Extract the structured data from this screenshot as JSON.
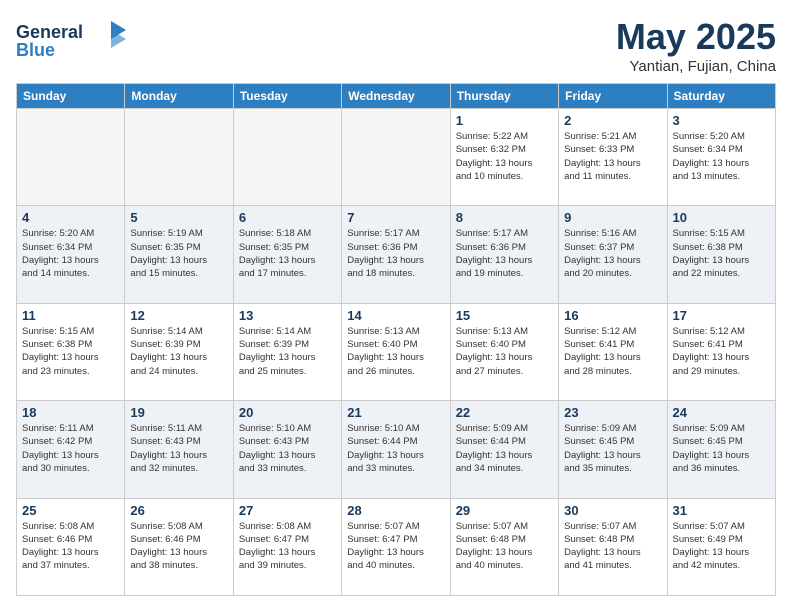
{
  "header": {
    "logo_line1": "General",
    "logo_line2": "Blue",
    "main_title": "May 2025",
    "subtitle": "Yantian, Fujian, China"
  },
  "days_of_week": [
    "Sunday",
    "Monday",
    "Tuesday",
    "Wednesday",
    "Thursday",
    "Friday",
    "Saturday"
  ],
  "weeks": [
    [
      {
        "day": "",
        "info": ""
      },
      {
        "day": "",
        "info": ""
      },
      {
        "day": "",
        "info": ""
      },
      {
        "day": "",
        "info": ""
      },
      {
        "day": "1",
        "info": "Sunrise: 5:22 AM\nSunset: 6:32 PM\nDaylight: 13 hours\nand 10 minutes."
      },
      {
        "day": "2",
        "info": "Sunrise: 5:21 AM\nSunset: 6:33 PM\nDaylight: 13 hours\nand 11 minutes."
      },
      {
        "day": "3",
        "info": "Sunrise: 5:20 AM\nSunset: 6:34 PM\nDaylight: 13 hours\nand 13 minutes."
      }
    ],
    [
      {
        "day": "4",
        "info": "Sunrise: 5:20 AM\nSunset: 6:34 PM\nDaylight: 13 hours\nand 14 minutes."
      },
      {
        "day": "5",
        "info": "Sunrise: 5:19 AM\nSunset: 6:35 PM\nDaylight: 13 hours\nand 15 minutes."
      },
      {
        "day": "6",
        "info": "Sunrise: 5:18 AM\nSunset: 6:35 PM\nDaylight: 13 hours\nand 17 minutes."
      },
      {
        "day": "7",
        "info": "Sunrise: 5:17 AM\nSunset: 6:36 PM\nDaylight: 13 hours\nand 18 minutes."
      },
      {
        "day": "8",
        "info": "Sunrise: 5:17 AM\nSunset: 6:36 PM\nDaylight: 13 hours\nand 19 minutes."
      },
      {
        "day": "9",
        "info": "Sunrise: 5:16 AM\nSunset: 6:37 PM\nDaylight: 13 hours\nand 20 minutes."
      },
      {
        "day": "10",
        "info": "Sunrise: 5:15 AM\nSunset: 6:38 PM\nDaylight: 13 hours\nand 22 minutes."
      }
    ],
    [
      {
        "day": "11",
        "info": "Sunrise: 5:15 AM\nSunset: 6:38 PM\nDaylight: 13 hours\nand 23 minutes."
      },
      {
        "day": "12",
        "info": "Sunrise: 5:14 AM\nSunset: 6:39 PM\nDaylight: 13 hours\nand 24 minutes."
      },
      {
        "day": "13",
        "info": "Sunrise: 5:14 AM\nSunset: 6:39 PM\nDaylight: 13 hours\nand 25 minutes."
      },
      {
        "day": "14",
        "info": "Sunrise: 5:13 AM\nSunset: 6:40 PM\nDaylight: 13 hours\nand 26 minutes."
      },
      {
        "day": "15",
        "info": "Sunrise: 5:13 AM\nSunset: 6:40 PM\nDaylight: 13 hours\nand 27 minutes."
      },
      {
        "day": "16",
        "info": "Sunrise: 5:12 AM\nSunset: 6:41 PM\nDaylight: 13 hours\nand 28 minutes."
      },
      {
        "day": "17",
        "info": "Sunrise: 5:12 AM\nSunset: 6:41 PM\nDaylight: 13 hours\nand 29 minutes."
      }
    ],
    [
      {
        "day": "18",
        "info": "Sunrise: 5:11 AM\nSunset: 6:42 PM\nDaylight: 13 hours\nand 30 minutes."
      },
      {
        "day": "19",
        "info": "Sunrise: 5:11 AM\nSunset: 6:43 PM\nDaylight: 13 hours\nand 32 minutes."
      },
      {
        "day": "20",
        "info": "Sunrise: 5:10 AM\nSunset: 6:43 PM\nDaylight: 13 hours\nand 33 minutes."
      },
      {
        "day": "21",
        "info": "Sunrise: 5:10 AM\nSunset: 6:44 PM\nDaylight: 13 hours\nand 33 minutes."
      },
      {
        "day": "22",
        "info": "Sunrise: 5:09 AM\nSunset: 6:44 PM\nDaylight: 13 hours\nand 34 minutes."
      },
      {
        "day": "23",
        "info": "Sunrise: 5:09 AM\nSunset: 6:45 PM\nDaylight: 13 hours\nand 35 minutes."
      },
      {
        "day": "24",
        "info": "Sunrise: 5:09 AM\nSunset: 6:45 PM\nDaylight: 13 hours\nand 36 minutes."
      }
    ],
    [
      {
        "day": "25",
        "info": "Sunrise: 5:08 AM\nSunset: 6:46 PM\nDaylight: 13 hours\nand 37 minutes."
      },
      {
        "day": "26",
        "info": "Sunrise: 5:08 AM\nSunset: 6:46 PM\nDaylight: 13 hours\nand 38 minutes."
      },
      {
        "day": "27",
        "info": "Sunrise: 5:08 AM\nSunset: 6:47 PM\nDaylight: 13 hours\nand 39 minutes."
      },
      {
        "day": "28",
        "info": "Sunrise: 5:07 AM\nSunset: 6:47 PM\nDaylight: 13 hours\nand 40 minutes."
      },
      {
        "day": "29",
        "info": "Sunrise: 5:07 AM\nSunset: 6:48 PM\nDaylight: 13 hours\nand 40 minutes."
      },
      {
        "day": "30",
        "info": "Sunrise: 5:07 AM\nSunset: 6:48 PM\nDaylight: 13 hours\nand 41 minutes."
      },
      {
        "day": "31",
        "info": "Sunrise: 5:07 AM\nSunset: 6:49 PM\nDaylight: 13 hours\nand 42 minutes."
      }
    ]
  ]
}
